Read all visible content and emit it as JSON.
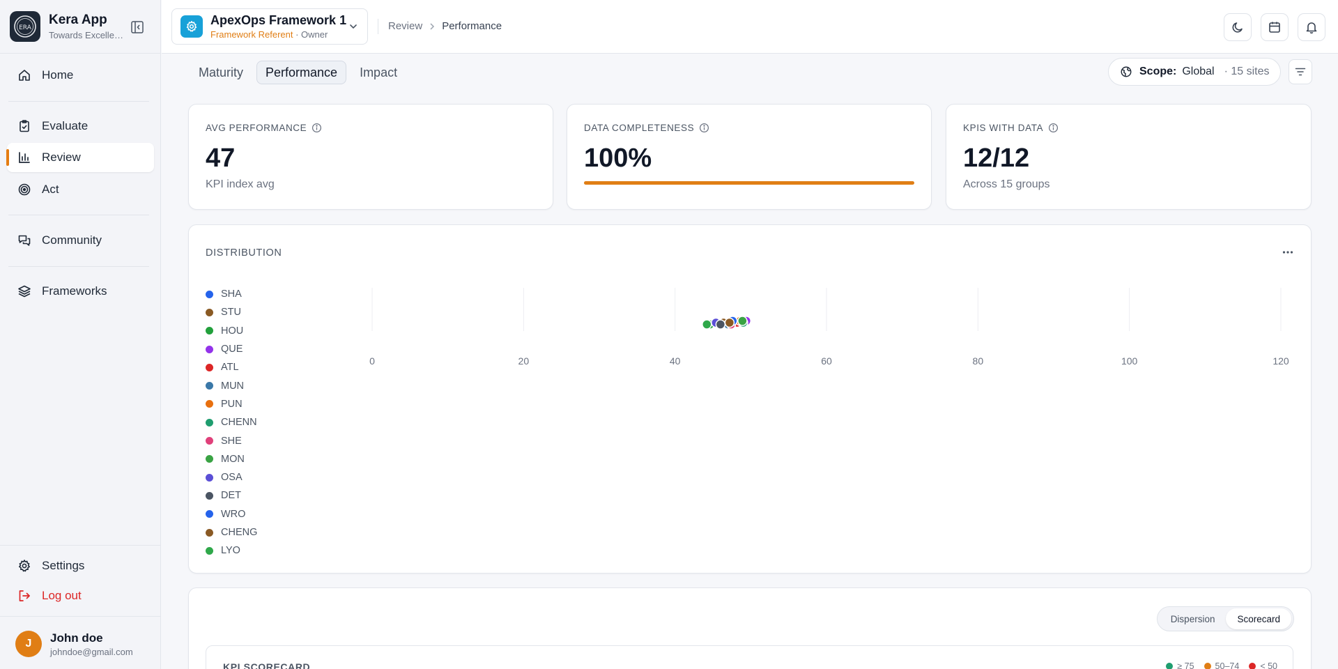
{
  "app": {
    "name": "Kera App",
    "tagline": "Towards Excellence",
    "logo_text": "ERA"
  },
  "sidebar": {
    "items": [
      {
        "id": "home",
        "label": "Home",
        "icon": "home-icon"
      },
      {
        "id": "evaluate",
        "label": "Evaluate",
        "icon": "clipboard-check-icon"
      },
      {
        "id": "review",
        "label": "Review",
        "icon": "bar-chart-icon",
        "active": true
      },
      {
        "id": "act",
        "label": "Act",
        "icon": "target-icon"
      },
      {
        "id": "community",
        "label": "Community",
        "icon": "chat-icon"
      },
      {
        "id": "frameworks",
        "label": "Frameworks",
        "icon": "layers-icon"
      }
    ],
    "settings_label": "Settings",
    "logout_label": "Log out"
  },
  "user": {
    "initial": "J",
    "name": "John doe",
    "email": "johndoe@gmail.com"
  },
  "header": {
    "framework": {
      "name": "ApexOps Framework 1",
      "role": "Framework Referent",
      "owner": "· Owner"
    },
    "breadcrumb": [
      "Review",
      "Performance"
    ]
  },
  "tabs": [
    "Maturity",
    "Performance",
    "Impact"
  ],
  "active_tab": "Performance",
  "scope": {
    "label": "Scope:",
    "value": "Global",
    "sites": "· 15 sites"
  },
  "kpis": [
    {
      "title": "AVG PERFORMANCE",
      "value": "47",
      "sub": "KPI index avg"
    },
    {
      "title": "DATA COMPLETENESS",
      "value": "100%",
      "progress": 1.0
    },
    {
      "title": "KPIS WITH DATA",
      "value": "12/12",
      "sub": "Across 15 groups"
    }
  ],
  "distribution": {
    "title": "DISTRIBUTION",
    "chart_data": {
      "type": "scatter",
      "x_ticks": [
        "0",
        "20",
        "40",
        "60",
        "80",
        "100",
        "120"
      ],
      "xlim": [
        0,
        120
      ],
      "grid": true,
      "legend_position": "left",
      "series": [
        {
          "name": "SHA",
          "color": "#2563eb",
          "x": 47.8
        },
        {
          "name": "STU",
          "color": "#8a5a24",
          "x": 46.4
        },
        {
          "name": "HOU",
          "color": "#22a03c",
          "x": 44.6
        },
        {
          "name": "QUE",
          "color": "#9333ea",
          "x": 49.4
        },
        {
          "name": "ATL",
          "color": "#dc2626",
          "x": 48.2
        },
        {
          "name": "MUN",
          "color": "#3a78a8",
          "x": 47.0
        },
        {
          "name": "PUN",
          "color": "#e8700f",
          "x": 48.6
        },
        {
          "name": "CHENN",
          "color": "#1f9d6f",
          "x": 49.0
        },
        {
          "name": "SHE",
          "color": "#e0407a",
          "x": 47.4
        },
        {
          "name": "MON",
          "color": "#3aa344",
          "x": 48.9
        },
        {
          "name": "OSA",
          "color": "#5b4fd6",
          "x": 45.4
        },
        {
          "name": "DET",
          "color": "#4b5563",
          "x": 46.0
        },
        {
          "name": "WRO",
          "color": "#2563eb",
          "x": 47.6
        },
        {
          "name": "CHENG",
          "color": "#8a5a24",
          "x": 47.2
        },
        {
          "name": "LYO",
          "color": "#2fa84a",
          "x": 44.2
        }
      ]
    }
  },
  "scorecard": {
    "toggle": [
      "Dispersion",
      "Scorecard"
    ],
    "active_toggle": "Scorecard",
    "title": "KPI SCORECARD",
    "thresholds": [
      {
        "label": "≥ 75",
        "color": "#1f9d6f"
      },
      {
        "label": "50–74",
        "color": "#e07e15"
      },
      {
        "label": "< 50",
        "color": "#dc2626"
      }
    ]
  }
}
